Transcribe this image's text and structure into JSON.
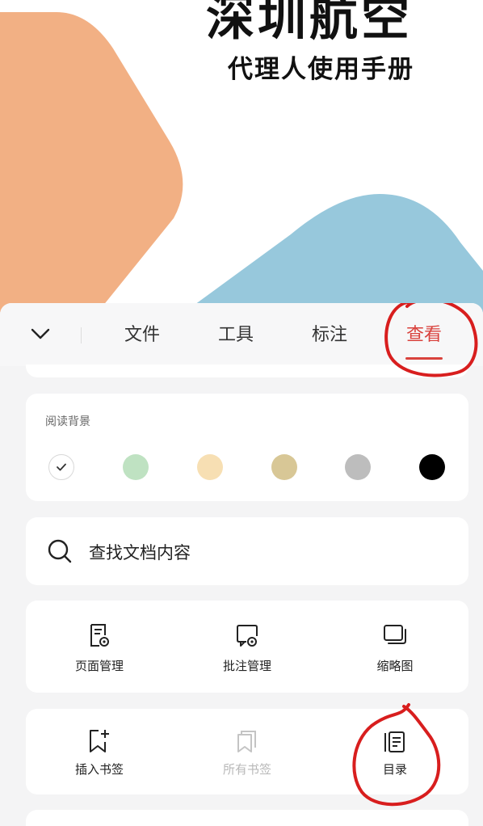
{
  "document": {
    "title": "深圳航空",
    "subtitle": "代理人使用手册",
    "colors": {
      "orange": "#f2b084",
      "blue": "#97c8dc"
    }
  },
  "tabbar": {
    "collapse_icon": "chevron-down-icon",
    "tabs": [
      {
        "label": "文件",
        "active": false
      },
      {
        "label": "工具",
        "active": false
      },
      {
        "label": "标注",
        "active": false
      },
      {
        "label": "查看",
        "active": true
      }
    ],
    "accent": "#d9423d"
  },
  "reading_background": {
    "label": "阅读背景",
    "swatches": [
      {
        "name": "white",
        "color": "#ffffff",
        "selected": true
      },
      {
        "name": "green",
        "color": "#bfe2c2",
        "selected": false
      },
      {
        "name": "beige",
        "color": "#f7dfb3",
        "selected": false
      },
      {
        "name": "khaki",
        "color": "#d8c796",
        "selected": false
      },
      {
        "name": "gray",
        "color": "#bdbdbd",
        "selected": false
      },
      {
        "name": "black",
        "color": "#000000",
        "selected": false
      }
    ]
  },
  "search": {
    "icon": "search-icon",
    "label": "查找文档内容"
  },
  "tools_row_1": [
    {
      "icon": "page-manage-icon",
      "label": "页面管理"
    },
    {
      "icon": "annotation-manage-icon",
      "label": "批注管理"
    },
    {
      "icon": "thumbnail-icon",
      "label": "缩略图"
    }
  ],
  "tools_row_2": [
    {
      "icon": "insert-bookmark-icon",
      "label": "插入书签",
      "enabled": true
    },
    {
      "icon": "all-bookmarks-icon",
      "label": "所有书签",
      "enabled": false
    },
    {
      "icon": "toc-icon",
      "label": "目录",
      "enabled": true
    }
  ]
}
